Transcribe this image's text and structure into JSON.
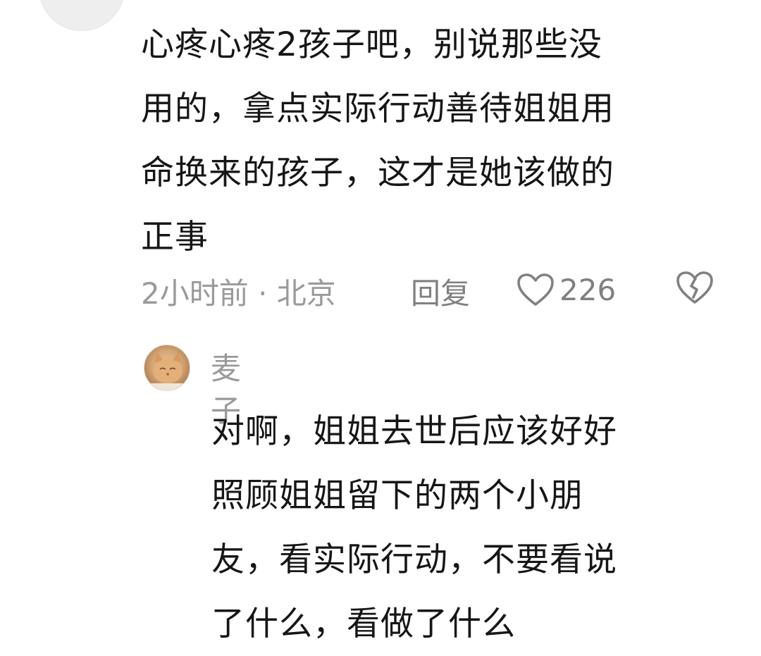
{
  "comment": {
    "text": "心疼心疼2孩子吧，别说那些没用的，拿点实际行动善待姐姐用命换来的孩子，这才是她该做的正事",
    "lines": [
      "心疼心疼2孩子吧，别说那些没",
      "用的，拿点实际行动善待姐姐用",
      "命换来的孩子，这才是她该做的",
      "正事"
    ],
    "meta": {
      "time_location": "2小时前 · 北京",
      "reply_label": "回复",
      "like_count": "226",
      "like_icon": "heart-outline-icon",
      "dislike_icon": "broken-heart-icon"
    }
  },
  "reply": {
    "author": "麦子",
    "avatar_icon": "cat-avatar",
    "lines": [
      "对啊，姐姐去世后应该好好",
      "照顾姐姐留下的两个小朋",
      "友，看实际行动，不要看说",
      "了什么，看做了什么"
    ]
  },
  "colors": {
    "text": "#161616",
    "meta": "#9a9a9a",
    "action": "#808080",
    "background": "#ffffff"
  }
}
